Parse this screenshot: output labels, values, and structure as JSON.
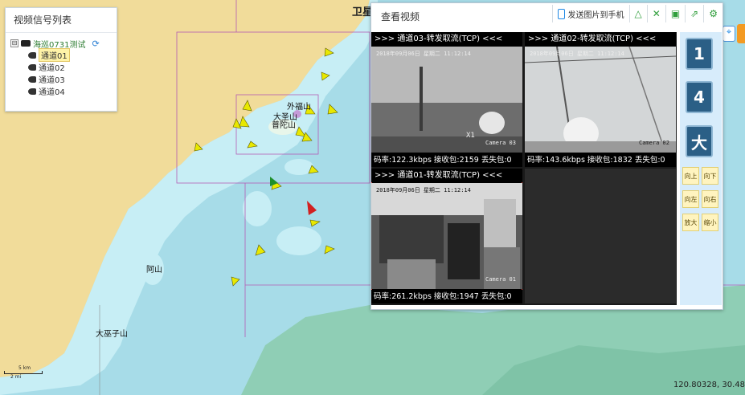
{
  "app": {
    "top_title": "卫星"
  },
  "map": {
    "labels": [
      "外福山",
      "大圣山",
      "普陀山",
      "阿山",
      "大巫子山"
    ],
    "scale": {
      "top": "5 km",
      "bottom": "2 mi"
    },
    "coords": "120.80328, 30.48"
  },
  "left_panel": {
    "title": "视频信号列表",
    "root": {
      "toggle": "⊟",
      "label": "海巡0731测试"
    },
    "channels": [
      "通道01",
      "通道02",
      "通道03",
      "通道04"
    ],
    "selected_channel": "通道01"
  },
  "video_window": {
    "title": "查看视频",
    "toolbar": {
      "send_label": "发送图片到手机",
      "icons": [
        "triangle-icon",
        "expand-icon",
        "save-icon",
        "export-icon",
        "gear-icon"
      ]
    },
    "tiles": [
      {
        "header": ">>> 通道03-转发取流(TCP) <<<",
        "stats": "码率:122.3kbps  接收包:2159  丢失包:0",
        "osd_time": "2018年09月06日 星期二 11:12:14",
        "osd_camera": "Camera 03",
        "osd_extra": "X1"
      },
      {
        "header": ">>> 通道02-转发取流(TCP) <<<",
        "stats": "码率:143.6kbps  接收包:1832  丢失包:0",
        "osd_time": "2018年09月06日 星期二 11:12:14",
        "osd_camera": "Camera 02"
      },
      {
        "header": ">>> 通道01-转发取流(TCP) <<<",
        "stats": "码率:261.2kbps  接收包:1947  丢失包:0",
        "osd_time": "2018年09月06日 星期二 11:12:14",
        "osd_camera": "Camera 01"
      }
    ],
    "layout_buttons": [
      "1",
      "4",
      "大"
    ],
    "ptz_buttons": [
      "向上",
      "向下",
      "向左",
      "向右",
      "放大",
      "缩小"
    ]
  },
  "colors": {
    "sea_deep": "#a7dce8",
    "sea_shallow": "#c7eef5",
    "land": "#f1dc9a",
    "green_sea": "#8fceb5",
    "ship": "#e8e800",
    "accent": "#2b5f86"
  }
}
